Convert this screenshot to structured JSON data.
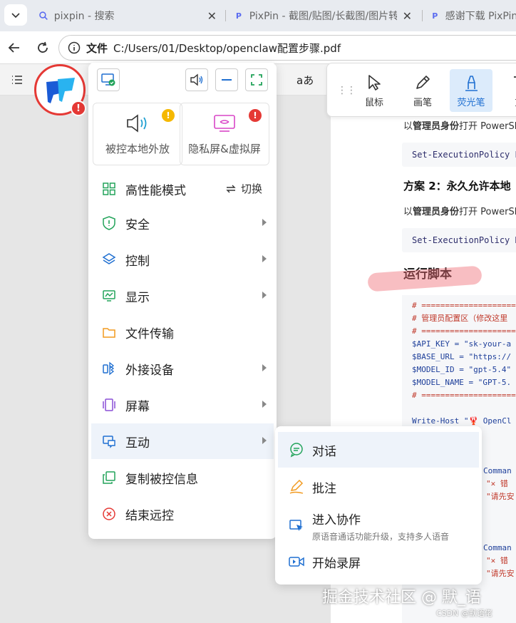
{
  "browser": {
    "tabs": [
      {
        "title": "pixpin - 搜索"
      },
      {
        "title": "PixPin - 截图/贴图/长截图/图片转"
      },
      {
        "title": "感谢下载 PixPin"
      }
    ],
    "address": {
      "label": "文件",
      "path": "C:/Users/01/Desktop/openclaw配置步骤.pdf"
    },
    "pdf_toolbar": {
      "text_size_glyph": "aあ"
    }
  },
  "annotation_tools": [
    {
      "label": "鼠标"
    },
    {
      "label": "画笔"
    },
    {
      "label": "荧光笔"
    },
    {
      "label": "文"
    }
  ],
  "document": {
    "line1_prefix": "以",
    "line1_bold": "管理员身份",
    "line1_suffix": "打开 PowerSh",
    "code1": "Set-ExecutionPolicy E",
    "heading2": "方案 2：永久允许本地",
    "line2_prefix": "以",
    "line2_bold": "管理员身份",
    "line2_suffix": "打开 PowerSh",
    "code2": "Set-ExecutionPolicy R",
    "heading3": "运行脚本",
    "code_lines": [
      {
        "cls": "cm",
        "text": "# ============================"
      },
      {
        "cls": "cm",
        "text": "# 管理员配置区（修改这里"
      },
      {
        "cls": "cm",
        "text": "# ============================"
      },
      {
        "cls": "kw",
        "text": "$API_KEY = \"sk-your-a"
      },
      {
        "cls": "kw",
        "text": "$BASE_URL = \"https://"
      },
      {
        "cls": "kw",
        "text": "$MODEL_ID = \"gpt-5.4\""
      },
      {
        "cls": "kw",
        "text": "$MODEL_NAME = \"GPT-5."
      },
      {
        "cls": "cm",
        "text": "# ============================"
      },
      {
        "cls": "kw",
        "text": ""
      },
      {
        "cls": "kw",
        "text": "Write-Host \"🦞 OpenCl"
      },
      {
        "cls": "kw",
        "text": "          ==========="
      }
    ],
    "code_frag_a1": "Comman",
    "code_frag_a2": "\"✕ 错",
    "code_frag_a3": "\"请先安",
    "code_frag_b1": "Comman",
    "code_frag_b2": "\"✕ 错",
    "code_frag_b3": "\"请先安"
  },
  "remote_menu": {
    "cards": [
      {
        "label": "被控本地外放",
        "indicator": "!"
      },
      {
        "label": "隐私屏&虚拟屏",
        "indicator": "!"
      }
    ],
    "items": [
      {
        "label": "高性能模式",
        "extra": "切换"
      },
      {
        "label": "安全"
      },
      {
        "label": "控制"
      },
      {
        "label": "显示"
      },
      {
        "label": "文件传输"
      },
      {
        "label": "外接设备"
      },
      {
        "label": "屏幕"
      },
      {
        "label": "互动"
      },
      {
        "label": "复制被控信息"
      },
      {
        "label": "结束远控"
      }
    ],
    "logo_badge": "!"
  },
  "submenu": {
    "items": [
      {
        "label": "对话"
      },
      {
        "label": "批注"
      },
      {
        "label": "进入协作",
        "sub": "原语音通话功能升级，支持多人语音"
      },
      {
        "label": "开始录屏"
      }
    ]
  },
  "watermark": "掘金技术社区 @ 默_语",
  "credit": "CSDN @默语佬"
}
